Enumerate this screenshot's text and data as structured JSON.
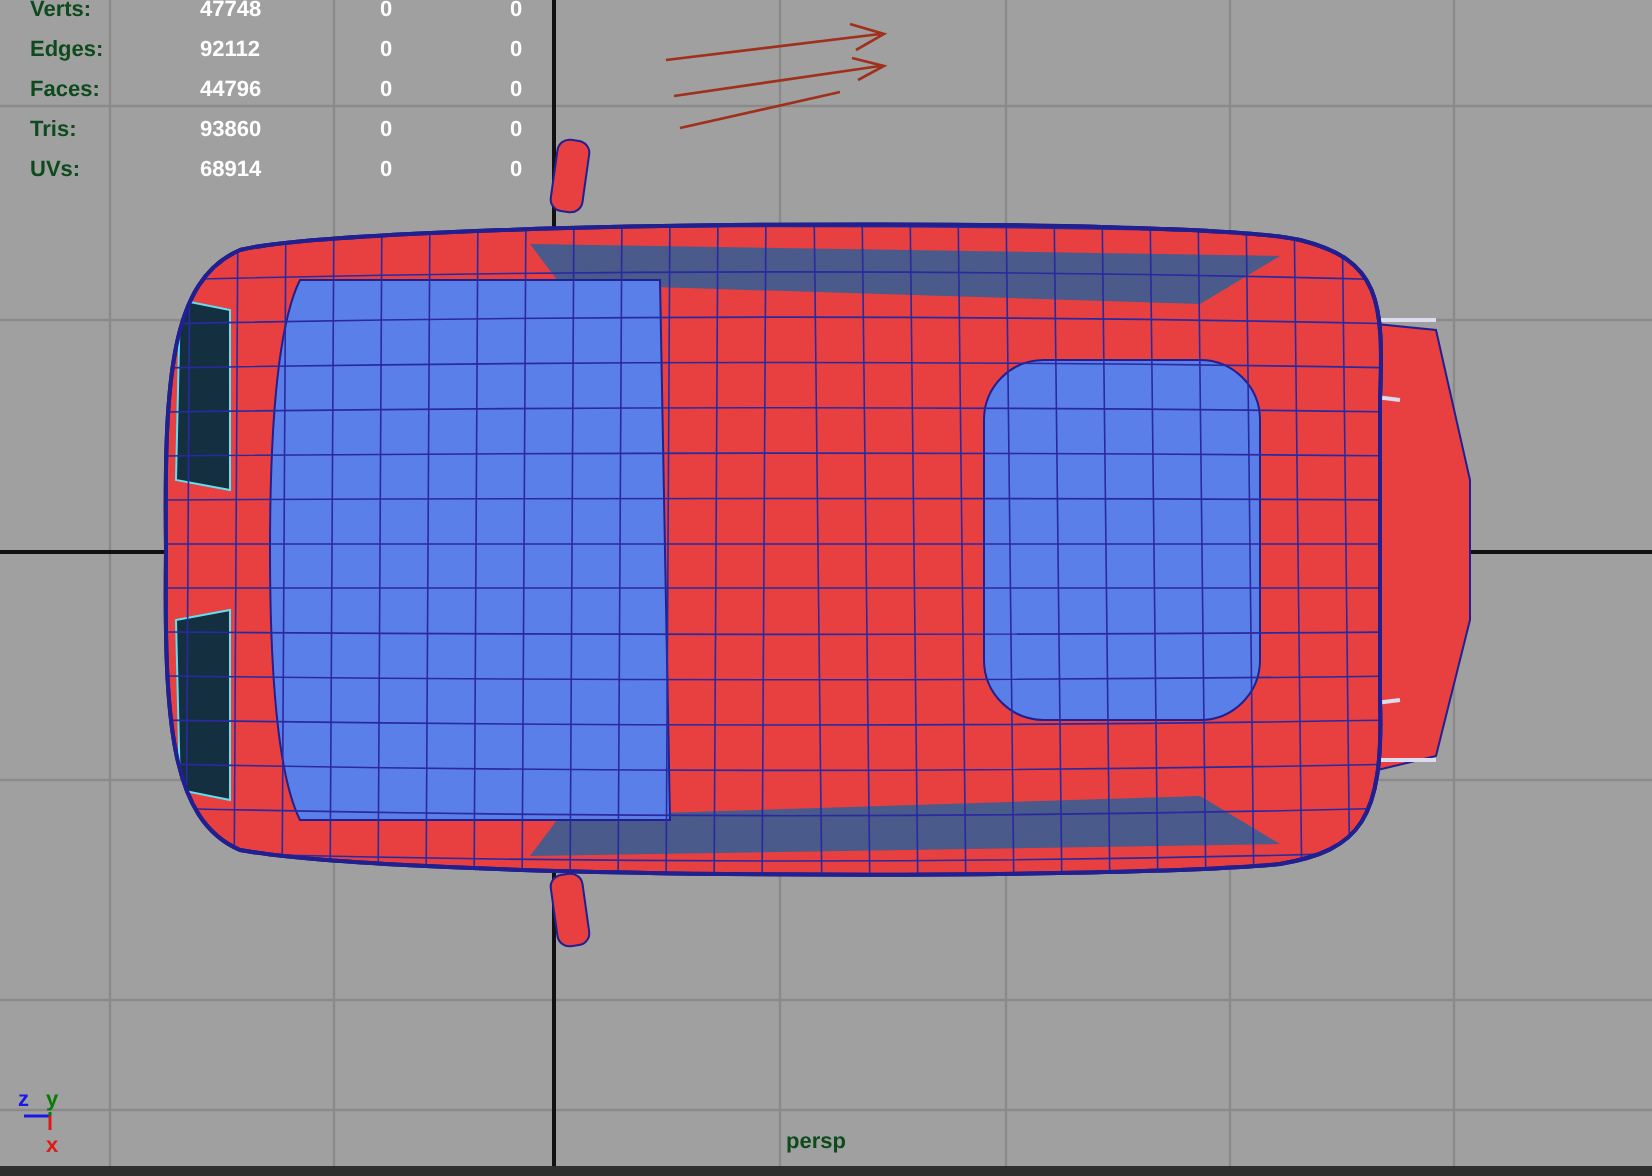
{
  "hud": {
    "rows": [
      {
        "label": "Verts:",
        "values": [
          "47748",
          "0",
          "0"
        ]
      },
      {
        "label": "Edges:",
        "values": [
          "92112",
          "0",
          "0"
        ]
      },
      {
        "label": "Faces:",
        "values": [
          "44796",
          "0",
          "0"
        ]
      },
      {
        "label": "Tris:",
        "values": [
          "93860",
          "0",
          "0"
        ]
      },
      {
        "label": "UVs:",
        "values": [
          "68914",
          "0",
          "0"
        ]
      }
    ]
  },
  "axis_gizmo": {
    "axes": [
      {
        "label": "z",
        "color": "#1818e8"
      },
      {
        "label": "y",
        "color": "#087a08"
      },
      {
        "label": "x",
        "color": "#e01818"
      }
    ]
  },
  "camera_label": "persp"
}
